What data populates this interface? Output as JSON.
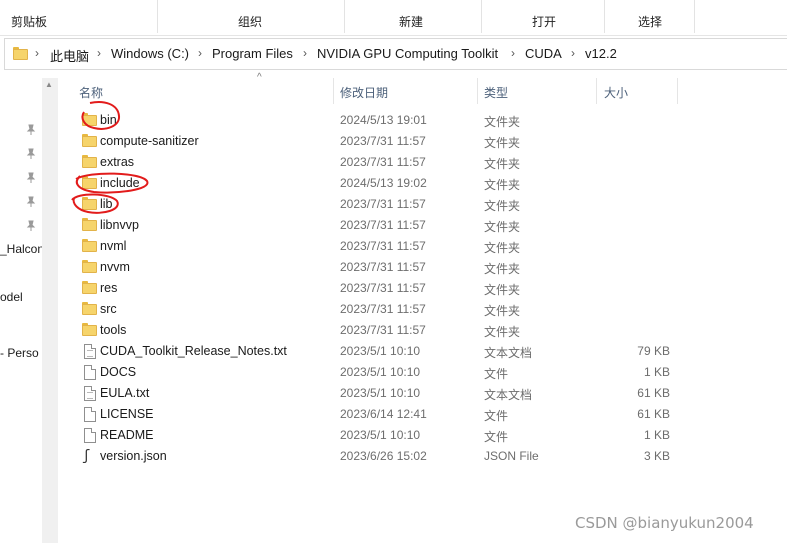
{
  "ribbon": {
    "groups": [
      "剪贴板",
      "组织",
      "新建",
      "打开",
      "选择"
    ]
  },
  "address": {
    "crumbs": [
      "此电脑",
      "Windows (C:)",
      "Program Files",
      "NVIDIA GPU Computing Toolkit",
      "CUDA",
      "v12.2"
    ]
  },
  "nav": {
    "items": [
      "_Halcon",
      "odel",
      "- Perso"
    ]
  },
  "columns": {
    "name": "名称",
    "date": "修改日期",
    "type": "类型",
    "size": "大小"
  },
  "files": [
    {
      "name": "bin",
      "date": "2024/5/13 19:01",
      "type": "文件夹",
      "size": "",
      "icon": "folder-icon"
    },
    {
      "name": "compute-sanitizer",
      "date": "2023/7/31 11:57",
      "type": "文件夹",
      "size": "",
      "icon": "folder-icon"
    },
    {
      "name": "extras",
      "date": "2023/7/31 11:57",
      "type": "文件夹",
      "size": "",
      "icon": "folder-icon"
    },
    {
      "name": "include",
      "date": "2024/5/13 19:02",
      "type": "文件夹",
      "size": "",
      "icon": "folder-icon"
    },
    {
      "name": "lib",
      "date": "2023/7/31 11:57",
      "type": "文件夹",
      "size": "",
      "icon": "folder-icon"
    },
    {
      "name": "libnvvp",
      "date": "2023/7/31 11:57",
      "type": "文件夹",
      "size": "",
      "icon": "folder-icon"
    },
    {
      "name": "nvml",
      "date": "2023/7/31 11:57",
      "type": "文件夹",
      "size": "",
      "icon": "folder-icon"
    },
    {
      "name": "nvvm",
      "date": "2023/7/31 11:57",
      "type": "文件夹",
      "size": "",
      "icon": "folder-icon"
    },
    {
      "name": "res",
      "date": "2023/7/31 11:57",
      "type": "文件夹",
      "size": "",
      "icon": "folder-icon"
    },
    {
      "name": "src",
      "date": "2023/7/31 11:57",
      "type": "文件夹",
      "size": "",
      "icon": "folder-icon"
    },
    {
      "name": "tools",
      "date": "2023/7/31 11:57",
      "type": "文件夹",
      "size": "",
      "icon": "folder-icon"
    },
    {
      "name": "CUDA_Toolkit_Release_Notes.txt",
      "date": "2023/5/1 10:10",
      "type": "文本文档",
      "size": "79 KB",
      "icon": "text-file-icon"
    },
    {
      "name": "DOCS",
      "date": "2023/5/1 10:10",
      "type": "文件",
      "size": "1 KB",
      "icon": "file-icon"
    },
    {
      "name": "EULA.txt",
      "date": "2023/5/1 10:10",
      "type": "文本文档",
      "size": "61 KB",
      "icon": "text-file-icon"
    },
    {
      "name": "LICENSE",
      "date": "2023/6/14 12:41",
      "type": "文件",
      "size": "61 KB",
      "icon": "file-icon"
    },
    {
      "name": "README",
      "date": "2023/5/1 10:10",
      "type": "文件",
      "size": "1 KB",
      "icon": "file-icon"
    },
    {
      "name": "version.json",
      "date": "2023/6/26 15:02",
      "type": "JSON File",
      "size": "3 KB",
      "icon": "json-file-icon"
    }
  ],
  "watermark": "CSDN @bianyukun2004"
}
